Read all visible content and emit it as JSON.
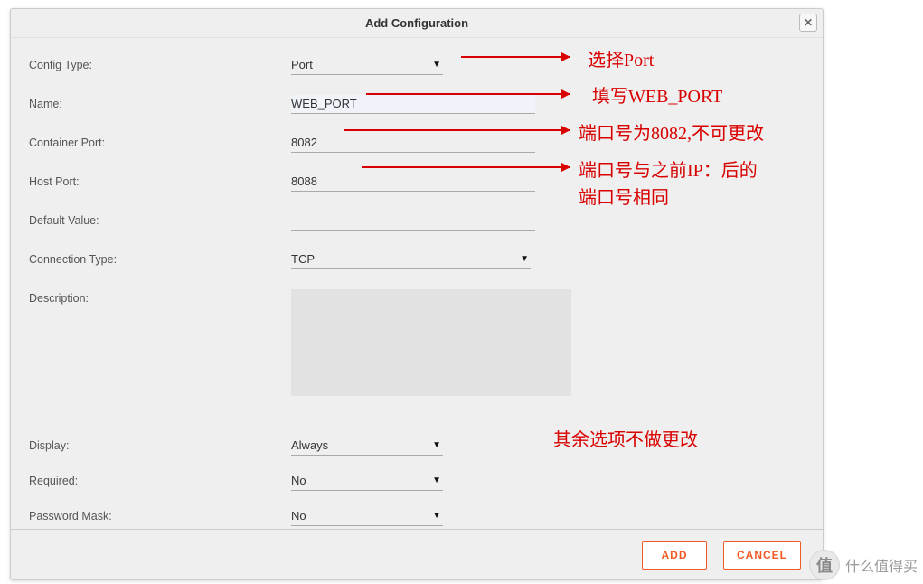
{
  "dialog": {
    "title": "Add Configuration",
    "labels": {
      "config_type": "Config Type:",
      "name": "Name:",
      "container_port": "Container Port:",
      "host_port": "Host Port:",
      "default_value": "Default Value:",
      "connection_type": "Connection Type:",
      "description": "Description:",
      "display": "Display:",
      "required": "Required:",
      "password_mask": "Password Mask:"
    },
    "values": {
      "config_type": "Port",
      "name": "WEB_PORT",
      "container_port": "8082",
      "host_port": "8088",
      "default_value": "",
      "connection_type": "TCP",
      "description": "",
      "display": "Always",
      "required": "No",
      "password_mask": "No"
    },
    "buttons": {
      "add": "ADD",
      "cancel": "CANCEL"
    }
  },
  "annotations": {
    "a1": "选择Port",
    "a2": "填写WEB_PORT",
    "a3": "端口号为8082,不可更改",
    "a4_line1": "端口号与之前IP：后的",
    "a4_line2": "端口号相同",
    "a5": "其余选项不做更改"
  },
  "watermark": {
    "icon": "值",
    "text": "什么值得买"
  }
}
